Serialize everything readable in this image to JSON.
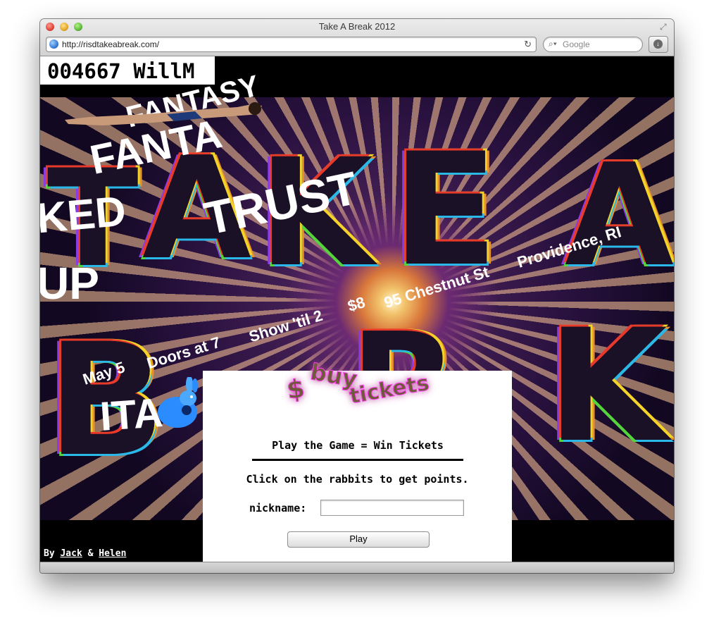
{
  "window": {
    "title": "Take A Break 2012"
  },
  "toolbar": {
    "url": "http://risdtakeabreak.com/",
    "search_placeholder": "Google"
  },
  "page": {
    "score": "004667 WillM",
    "poster": {
      "big_letters_top": "TAKE A",
      "big_letters_bottom": "BREAK",
      "overlay_words": [
        "FANTASY",
        "FANTA",
        "KED",
        "UP",
        "TRUST",
        "ITA"
      ],
      "details": {
        "date": "May 5",
        "doors": "Doors at 7",
        "show": "Show 'til 2",
        "price": "$8",
        "address": "95 Chestnut St",
        "city": "Providence, RI"
      }
    },
    "game": {
      "buy_tickets_symbol": "$",
      "buy_label": "buy",
      "tickets_label": "tickets",
      "title": "Play the Game = Win Tickets",
      "instructions": "Click on the rabbits to get points.",
      "nickname_label": "nickname:",
      "nickname_value": "",
      "play_label": "Play"
    },
    "credits": {
      "prefix": "By",
      "author1": "Jack",
      "separator": "&",
      "author2": "Helen"
    }
  }
}
